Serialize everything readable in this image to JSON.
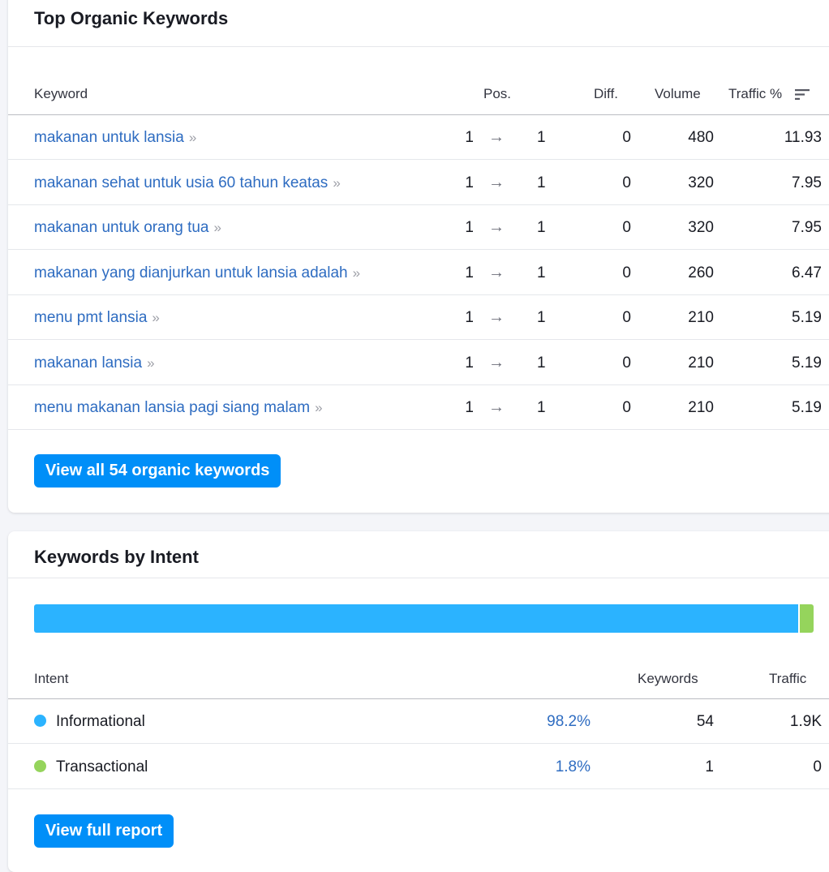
{
  "top_keywords": {
    "title": "Top Organic Keywords",
    "columns": {
      "keyword": "Keyword",
      "pos": "Pos.",
      "diff": "Diff.",
      "volume": "Volume",
      "traffic": "Traffic %"
    },
    "sort_icon": "sort-descending-icon",
    "chevron_glyph": "»",
    "arrow_glyph": "→",
    "rows": [
      {
        "keyword": "makanan untuk lansia",
        "pos_from": "1",
        "pos_to": "1",
        "diff": "0",
        "volume": "480",
        "traffic": "11.93"
      },
      {
        "keyword": "makanan sehat untuk usia 60 tahun keatas",
        "pos_from": "1",
        "pos_to": "1",
        "diff": "0",
        "volume": "320",
        "traffic": "7.95"
      },
      {
        "keyword": "makanan untuk orang tua",
        "pos_from": "1",
        "pos_to": "1",
        "diff": "0",
        "volume": "320",
        "traffic": "7.95"
      },
      {
        "keyword": "makanan yang dianjurkan untuk lansia adalah",
        "pos_from": "1",
        "pos_to": "1",
        "diff": "0",
        "volume": "260",
        "traffic": "6.47"
      },
      {
        "keyword": "menu pmt lansia",
        "pos_from": "1",
        "pos_to": "1",
        "diff": "0",
        "volume": "210",
        "traffic": "5.19"
      },
      {
        "keyword": "makanan lansia",
        "pos_from": "1",
        "pos_to": "1",
        "diff": "0",
        "volume": "210",
        "traffic": "5.19"
      },
      {
        "keyword": "menu makanan lansia pagi siang malam",
        "pos_from": "1",
        "pos_to": "1",
        "diff": "0",
        "volume": "210",
        "traffic": "5.19"
      }
    ],
    "view_all_label": "View all 54 organic keywords"
  },
  "intent": {
    "title": "Keywords by Intent",
    "bar": [
      {
        "name": "Informational",
        "share": 98.2,
        "color": "#2bb3ff"
      },
      {
        "name": "Transactional",
        "share": 1.8,
        "color": "#95d45c"
      }
    ],
    "columns": {
      "intent": "Intent",
      "keywords": "Keywords",
      "traffic": "Traffic"
    },
    "rows": [
      {
        "name": "Informational",
        "pct": "98.2%",
        "keywords": "54",
        "traffic": "1.9K",
        "color": "#2bb3ff"
      },
      {
        "name": "Transactional",
        "pct": "1.8%",
        "keywords": "1",
        "traffic": "0",
        "color": "#95d45c"
      }
    ],
    "view_report_label": "View full report"
  },
  "colors": {
    "link": "#2e6cc1",
    "button": "#008ff8"
  }
}
